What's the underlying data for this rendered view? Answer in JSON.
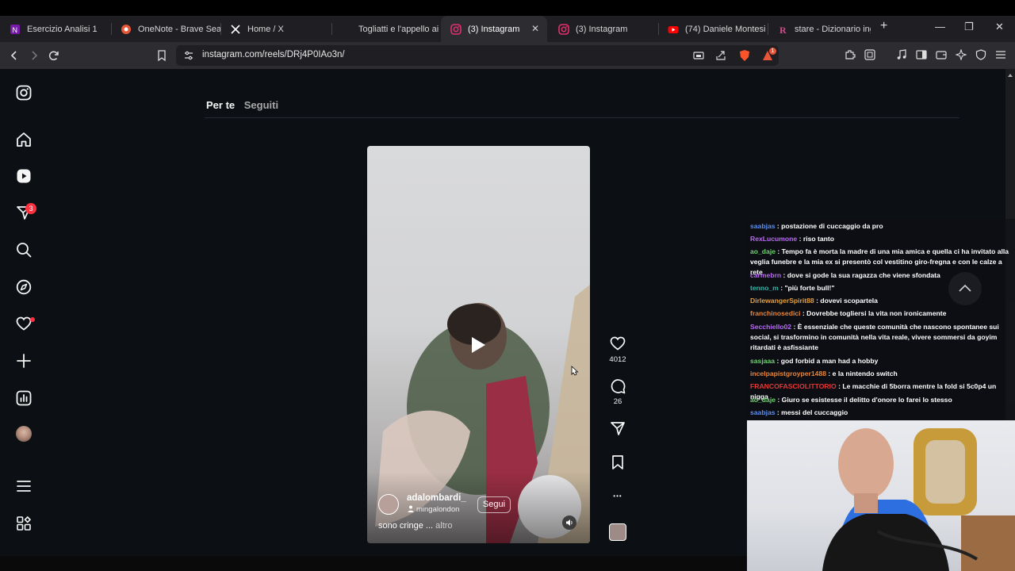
{
  "browser": {
    "tabs": [
      {
        "title": "Esercizio Analisi 1",
        "icon": "onenote-icon"
      },
      {
        "title": "OneNote - Brave Sear",
        "icon": "brave-search-icon"
      },
      {
        "title": "Home / X",
        "icon": "x-logo-icon"
      },
      {
        "title": "Togliatti e l'appello ai",
        "icon": "page-icon"
      },
      {
        "title": "(3) Instagram",
        "icon": "instagram-icon",
        "active": true
      },
      {
        "title": "(3) Instagram",
        "icon": "instagram-icon"
      },
      {
        "title": "(74) Daniele Montesi",
        "icon": "youtube-icon"
      },
      {
        "title": "stare - Dizionario ingl",
        "icon": "dictionary-icon"
      }
    ],
    "close_glyph": "✕",
    "new_tab_glyph": "+",
    "window_controls": {
      "minimize": "—",
      "maximize": "❐",
      "close": "✕"
    },
    "url": "instagram.com/reels/DRj4P0IAo3n/",
    "notification_count": "1"
  },
  "instagram": {
    "notifications_badge": "3",
    "feed_tabs": [
      "Per te",
      "Seguiti"
    ],
    "reel": {
      "author": "adalombardi_",
      "audio": "mingalondon",
      "follow_label": "Segui",
      "caption": "sono cringe ...",
      "more_label": "altro",
      "likes": "4012",
      "comments": "26"
    },
    "more_glyph": "•••"
  },
  "stream_chat": [
    {
      "user": "saabjas",
      "color": "#5b8def",
      "text": ": postazione di cuccaggio da pro"
    },
    {
      "user": "RexLucumone",
      "color": "#b86cf0",
      "text": ": riso tanto"
    },
    {
      "user": "ao_daje",
      "color": "#6fd26f",
      "text": ": Tempo fa è morta la madre di una mia amica e quella ci ha invitato alla veglia funebre e la mia ex si presentò col vestitino giro-fregna e con le calze a rete"
    },
    {
      "user": "carmebrn",
      "color": "#b86cf0",
      "text": ": dove si gode la sua ragazza che viene sfondata"
    },
    {
      "user": "tenno_m",
      "color": "#2fb8a8",
      "text": ": \"più forte bull!\""
    },
    {
      "user": "DirlewangerSpirit88",
      "color": "#e8a13a",
      "text": ": dovevi scopartela"
    },
    {
      "user": "franchinosedici",
      "color": "#e8853a",
      "text": ": Dovrebbe togliersi la vita non ironicamente"
    },
    {
      "user": "Secchiello02",
      "color": "#b86cf0",
      "text": ": È essenziale che queste comunità che nascono spontanee sui social, si trasformino in comunità nella vita reale, vivere sommersi da goyim ritardati è asfissiante"
    },
    {
      "user": "sasjaaa",
      "color": "#6fd26f",
      "text": ": god forbid a man had a hobby"
    },
    {
      "user": "incelpapistgroyper1488",
      "color": "#e8853a",
      "text": ": e la nintendo switch"
    },
    {
      "user": "FRANCOFASCIOLITTORIO",
      "color": "#e53935",
      "text": ": Le macchie di 5borra mentre la fold si 5c0p4 un nigga"
    },
    {
      "user": "ao_daje",
      "color": "#6fd26f",
      "text": ": Giuro se esistesse il delitto d'onore lo farei lo stesso"
    },
    {
      "user": "saabjas",
      "color": "#5b8def",
      "text": ": messi del cuccaggio"
    }
  ],
  "colors": {
    "ig_background": "#0c0f14",
    "badge": "#ff3040",
    "browser_chrome": "#2c2c31"
  }
}
